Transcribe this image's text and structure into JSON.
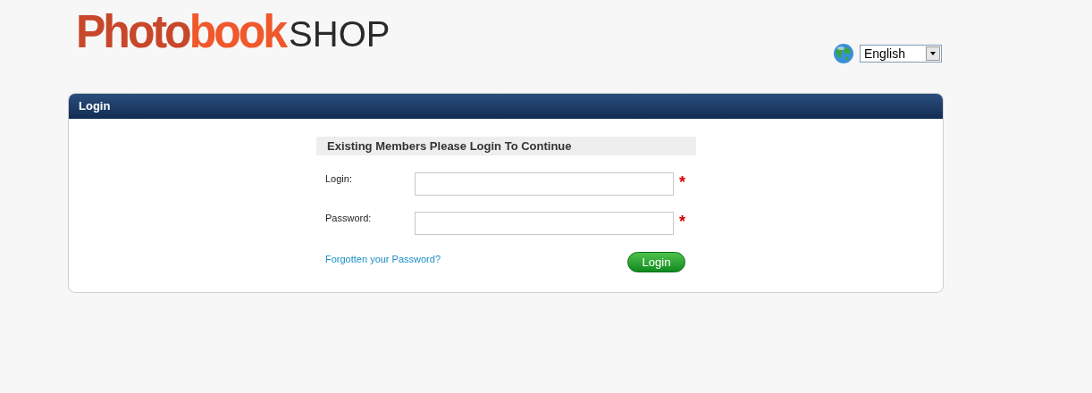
{
  "logo": {
    "parts": [
      {
        "text": "Photo",
        "color": "#c8472a"
      },
      {
        "text": "book",
        "color": "#f0582c"
      },
      {
        "text": "SHOP",
        "color": "#2a2a2a"
      }
    ]
  },
  "language": {
    "value": "English"
  },
  "panel": {
    "title": "Login"
  },
  "form": {
    "heading": "Existing Members Please Login To Continue",
    "fields": [
      {
        "label": "Login:",
        "required": true
      },
      {
        "label": "Password:",
        "required": true
      }
    ],
    "required_mark": "*",
    "forgot_link": "Forgotten your Password?",
    "submit": "Login"
  }
}
